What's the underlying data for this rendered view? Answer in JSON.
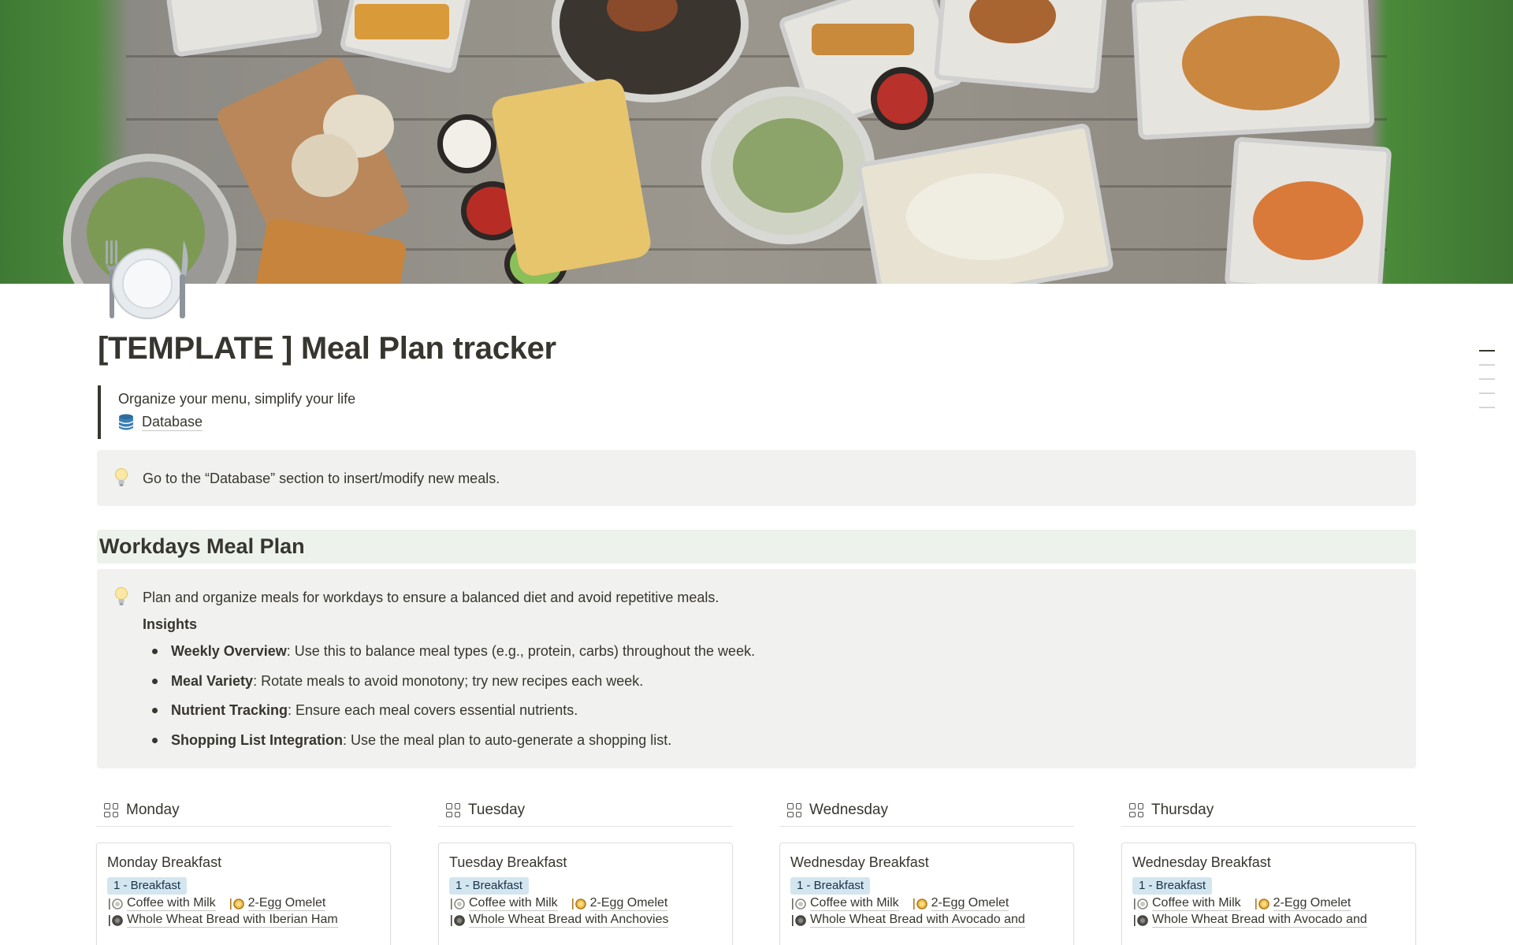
{
  "page": {
    "title": "[TEMPLATE ] Meal Plan tracker",
    "tagline": "Organize your menu, simplify your life",
    "database_link": "Database",
    "callout_database": "Go to the “Database” section to insert/modify new meals.",
    "icons": {
      "page": "plate-with-cutlery-icon",
      "database": "database-icon",
      "callout": "lightbulb-icon"
    }
  },
  "workdays": {
    "heading": "Workdays Meal Plan",
    "intro": "Plan and organize meals for workdays to ensure a balanced diet and avoid repetitive meals.",
    "insights_label": "Insights",
    "insights": [
      {
        "term": "Weekly Overview",
        "text": ": Use this to balance meal types (e.g., protein, carbs) throughout the week."
      },
      {
        "term": "Meal Variety",
        "text": ": Rotate meals to avoid monotony; try new recipes each week."
      },
      {
        "term": "Nutrient Tracking",
        "text": ": Ensure each meal covers essential nutrients."
      },
      {
        "term": "Shopping List Integration",
        "text": ": Use the meal plan to auto-generate a shopping list."
      }
    ]
  },
  "days": [
    {
      "name": "Monday",
      "card": {
        "title": "Monday Breakfast",
        "tag": "1 - Breakfast",
        "item1": "Coffee with Milk",
        "item2": "2-Egg Omelet",
        "item3": "Whole Wheat Bread with Iberian Ham"
      }
    },
    {
      "name": "Tuesday",
      "card": {
        "title": "Tuesday Breakfast",
        "tag": "1 - Breakfast",
        "item1": "Coffee with Milk",
        "item2": "2-Egg Omelet",
        "item3": "Whole Wheat Bread with Anchovies"
      }
    },
    {
      "name": "Wednesday",
      "card": {
        "title": "Wednesday Breakfast",
        "tag": "1 - Breakfast",
        "item1": "Coffee with Milk",
        "item2": "2-Egg Omelet",
        "item3": "Whole Wheat Bread with Avocado and"
      }
    },
    {
      "name": "Thursday",
      "card": {
        "title": "Wednesday Breakfast",
        "tag": "1 - Breakfast",
        "item1": "Coffee with Milk",
        "item2": "2-Egg Omelet",
        "item3": "Whole Wheat Bread with Avocado and"
      }
    }
  ],
  "colors": {
    "text": "#37352f",
    "callout_bg": "#f1f1ef",
    "heading_bg": "#edf3ec",
    "tag_bg": "#d3e5ef",
    "tag_text": "#183347"
  }
}
